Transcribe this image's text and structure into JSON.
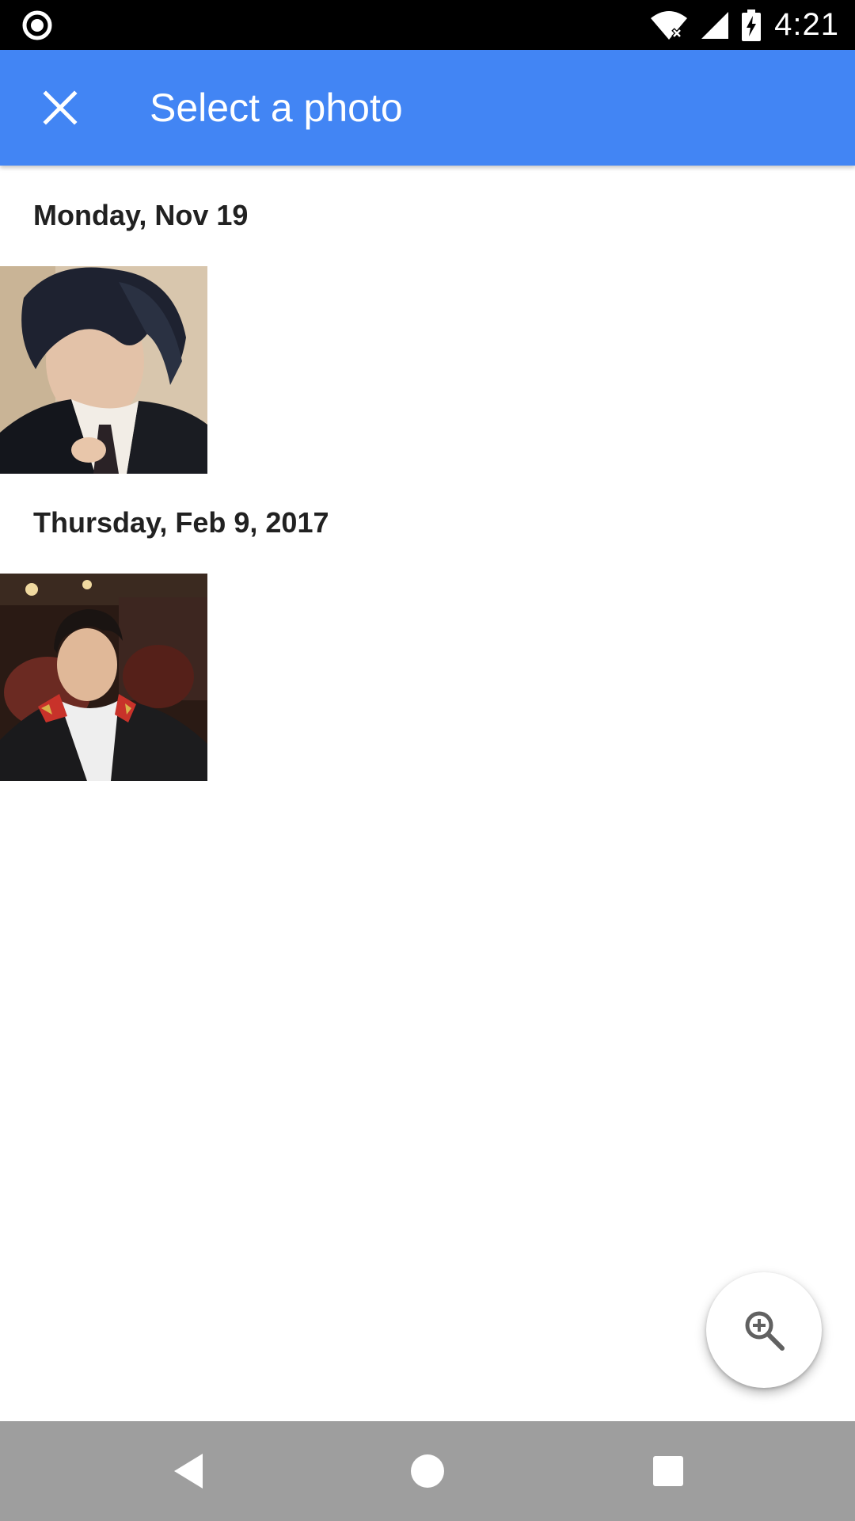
{
  "status_bar": {
    "time": "4:21",
    "icons": [
      "record-icon",
      "wifi-off-icon",
      "cell-signal-icon",
      "battery-charging-icon"
    ]
  },
  "app_bar": {
    "title": "Select a photo",
    "close_icon": "close-icon",
    "background_color": "#4285f4"
  },
  "sections": [
    {
      "date": "Monday, Nov 19",
      "photos": [
        "portrait-boy-dark-hair"
      ]
    },
    {
      "date": "Thursday, Feb 9, 2017",
      "photos": [
        "portrait-man-jacket"
      ]
    }
  ],
  "fab": {
    "icon": "zoom-in-icon"
  },
  "nav_bar": {
    "buttons": [
      "back-icon",
      "home-icon",
      "recents-icon"
    ]
  }
}
